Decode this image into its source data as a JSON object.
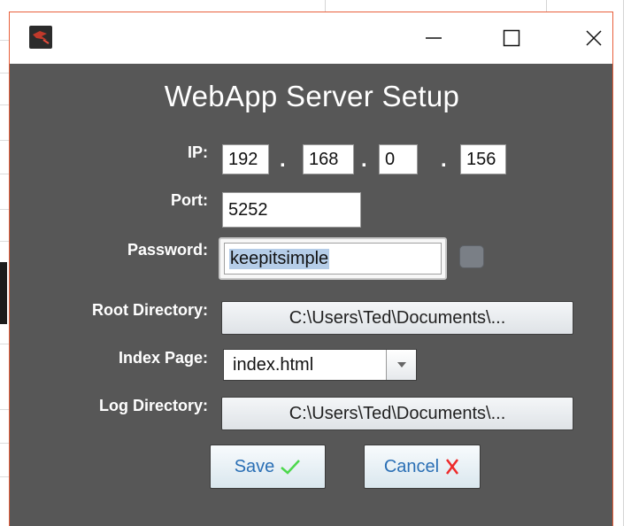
{
  "window": {
    "heading": "WebApp Server Setup"
  },
  "form": {
    "ip": {
      "label": "IP:",
      "octets": [
        "192",
        "168",
        "0",
        "156"
      ],
      "separator": "."
    },
    "port": {
      "label": "Port:",
      "value": "5252"
    },
    "password": {
      "label": "Password:",
      "value": "keepitsimple",
      "selected": true
    },
    "root_directory": {
      "label": "Root Directory:",
      "value": "C:\\Users\\Ted\\Documents\\..."
    },
    "index_page": {
      "label": "Index Page:",
      "selected": "index.html"
    },
    "log_directory": {
      "label": "Log Directory:",
      "value": "C:\\Users\\Ted\\Documents\\..."
    }
  },
  "actions": {
    "save_label": "Save",
    "cancel_label": "Cancel"
  },
  "icons": {
    "save": "checkmark-icon",
    "cancel": "x-icon",
    "app": "app-logo-icon",
    "minimize": "minimize-icon",
    "maximize": "maximize-icon",
    "close": "close-icon",
    "dropdown": "chevron-down-icon"
  },
  "colors": {
    "dialog_background": "#575757",
    "window_border": "#e8603c",
    "save_check": "#4cd84c",
    "cancel_x": "#ee2a2a",
    "button_text": "#2a6fb5"
  }
}
